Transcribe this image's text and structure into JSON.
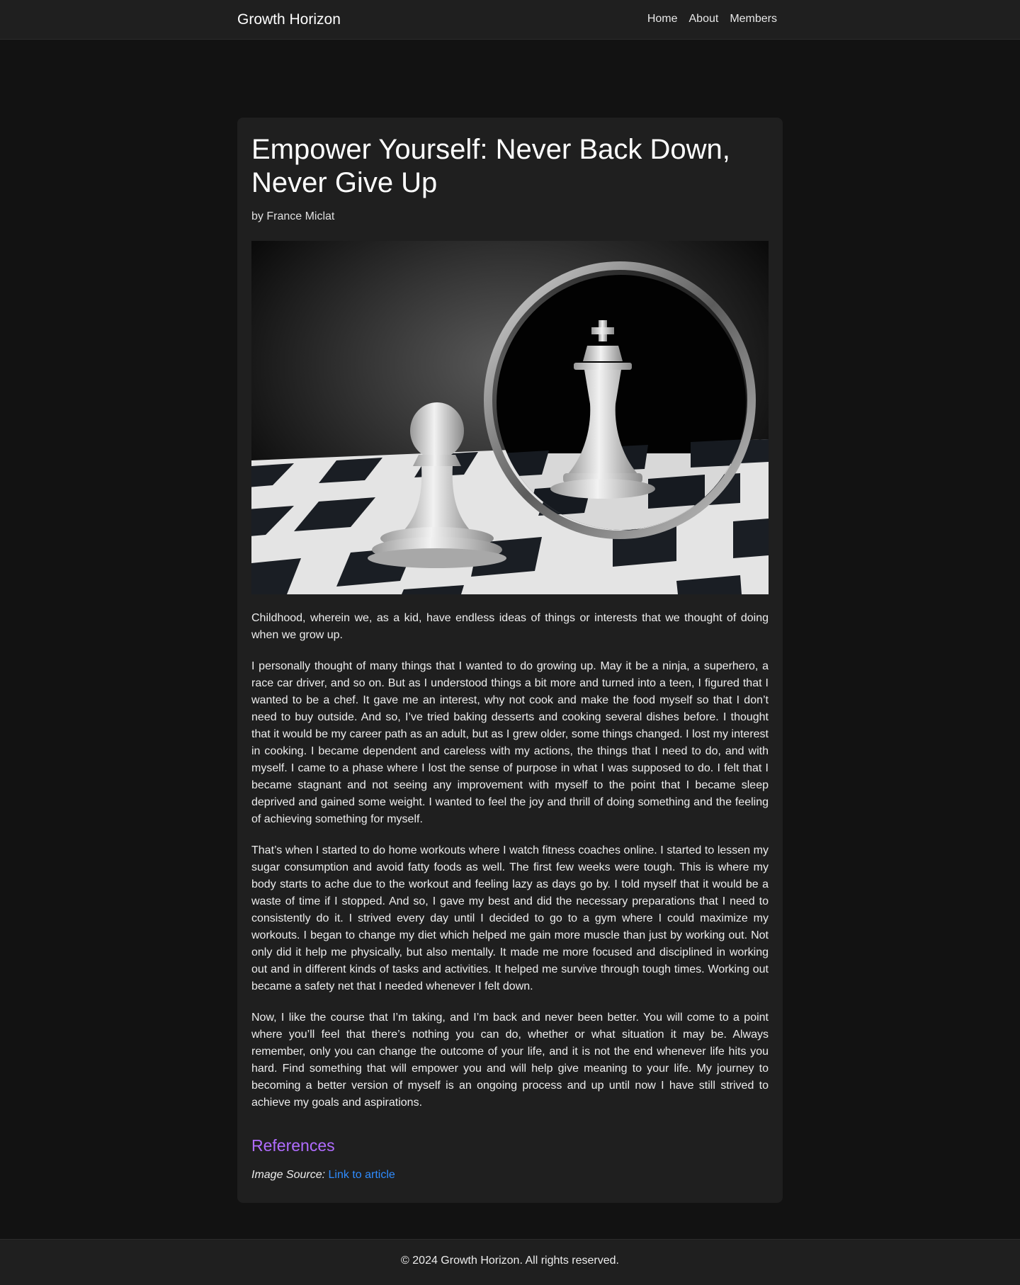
{
  "header": {
    "brand": "Growth Horizon",
    "nav": [
      "Home",
      "About",
      "Members"
    ]
  },
  "article": {
    "title": "Empower Yourself: Never Back Down, Never Give Up",
    "author": "by France Miclat",
    "image_subject": "chess-pawn-mirror-king",
    "paragraphs": [
      "Childhood, wherein we, as a kid, have endless ideas of things or interests that we thought of doing when we grow up.",
      "I personally thought of many things that I wanted to do growing up. May it be a ninja, a superhero, a race car driver, and so on. But as I understood things a bit more and turned into a teen, I figured that I wanted to be a chef. It gave me an interest, why not cook and make the food myself so that I don’t need to buy outside. And so, I’ve tried baking desserts and cooking several dishes before. I thought that it would be my career path as an adult, but as I grew older, some things changed. I lost my interest in cooking. I became dependent and careless with my actions, the things that I need to do, and with myself. I came to a phase where I lost the sense of purpose in what I was supposed to do. I felt that I became stagnant and not seeing any improvement with myself to the point that I became sleep deprived and gained some weight. I wanted to feel the joy and thrill of doing something and the feeling of achieving something for myself.",
      "That’s when I started to do home workouts where I watch fitness coaches online. I started to lessen my sugar consumption and avoid fatty foods as well. The first few weeks were tough. This is where my body starts to ache due to the workout and feeling lazy as days go by. I told myself that it would be a waste of time if I stopped. And so, I gave my best and did the necessary preparations that I need to consistently do it. I strived every day until I decided to go to a gym where I could maximize my workouts. I began to change my diet which helped me gain more muscle than just by working out. Not only did it help me physically, but also mentally. It made me more focused and disciplined in working out and in different kinds of tasks and activities. It helped me survive through tough times. Working out became a safety net that I needed whenever I felt down.",
      "Now, I like the course that I’m taking, and I’m back and never been better. You will come to a point where you’ll feel that there’s nothing you can do, whether or what situation it may be. Always remember, only you can change the outcome of your life, and it is not the end whenever life hits you hard. Find something that will empower you and will help give meaning to your life. My journey to becoming a better version of myself is an ongoing process and up until now I have still strived to achieve my goals and aspirations."
    ]
  },
  "references": {
    "heading": "References",
    "label": "Image Source:",
    "link_text": "Link to article"
  },
  "footer": {
    "text": "© 2024 Growth Horizon. All rights reserved."
  },
  "colors": {
    "page_bg": "#121212",
    "surface": "#1f1f1f",
    "accent_heading": "#b06cff",
    "link": "#2f8cff"
  }
}
